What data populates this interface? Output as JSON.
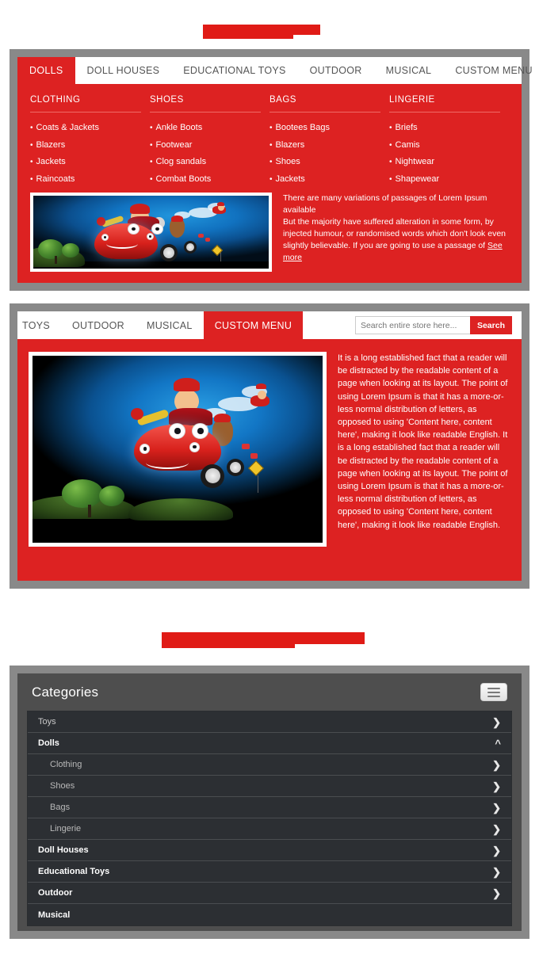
{
  "redacted_titles": [
    {
      "name": "title-block-top"
    },
    {
      "name": "title-block-middle"
    }
  ],
  "megamenu": {
    "tabs": [
      {
        "label": "DOLLS",
        "active": true
      },
      {
        "label": "DOLL HOUSES",
        "active": false
      },
      {
        "label": "EDUCATIONAL TOYS",
        "active": false
      },
      {
        "label": "OUTDOOR",
        "active": false
      },
      {
        "label": "MUSICAL",
        "active": false
      },
      {
        "label": "CUSTOM MENU",
        "active": false
      }
    ],
    "columns": [
      {
        "title": "CLOTHING",
        "items": [
          "Coats & Jackets",
          "Blazers",
          "Jackets",
          "Raincoats"
        ]
      },
      {
        "title": "SHOES",
        "items": [
          "Ankle Boots",
          "Footwear",
          "Clog sandals",
          "Combat Boots"
        ]
      },
      {
        "title": "BAGS",
        "items": [
          "Bootees  Bags",
          "Blazers",
          "Shoes",
          "Jackets"
        ]
      },
      {
        "title": "LINGERIE",
        "items": [
          "Briefs",
          "Camis",
          "Nightwear",
          "Shapewear"
        ]
      }
    ],
    "promo_text_1": "There are many variations of passages of Lorem Ipsum available",
    "promo_text_2": "But the majority have suffered alteration in some form, by injected humour, or randomised words which don't look even slightly believable. If you are going to use a passage of ",
    "promo_link": "See more",
    "image_alt": "cartoon-red-car-with-characters"
  },
  "searchpanel": {
    "tabs": [
      {
        "label": "TOYS",
        "active": false,
        "clipped": true
      },
      {
        "label": "OUTDOOR",
        "active": false,
        "clipped": false
      },
      {
        "label": "MUSICAL",
        "active": false,
        "clipped": false
      },
      {
        "label": "CUSTOM MENU",
        "active": true,
        "clipped": false
      }
    ],
    "search": {
      "placeholder": "Search entire store here...",
      "value": "",
      "button_label": "Search"
    },
    "body_text": "It is a long established fact that a reader will be distracted by the readable content of a page when looking at its layout. The point of using Lorem Ipsum is that it has a more-or-less normal distribution of letters, as opposed to using 'Content here, content here', making it look like readable English. It is a long established fact that a reader will be distracted by the readable content of a page when looking at its layout. The point of using Lorem Ipsum is that it has a more-or-less normal distribution of letters, as opposed to using 'Content here, content here', making it look like readable English.",
    "image_alt": "cartoon-red-car-flying-over-hill"
  },
  "categories": {
    "title": "Categories",
    "toggle_icon": "hamburger-icon",
    "rows": [
      {
        "label": "Toys",
        "level": 0,
        "bold": false,
        "chevron": "right"
      },
      {
        "label": "Dolls",
        "level": 0,
        "bold": true,
        "chevron": "up"
      },
      {
        "label": "Clothing",
        "level": 1,
        "bold": false,
        "chevron": "right"
      },
      {
        "label": "Shoes",
        "level": 1,
        "bold": false,
        "chevron": "right"
      },
      {
        "label": "Bags",
        "level": 1,
        "bold": false,
        "chevron": "right"
      },
      {
        "label": "Lingerie",
        "level": 1,
        "bold": false,
        "chevron": "right"
      },
      {
        "label": "Doll Houses",
        "level": 0,
        "bold": true,
        "chevron": "right"
      },
      {
        "label": "Educational Toys",
        "level": 0,
        "bold": true,
        "chevron": "right"
      },
      {
        "label": "Outdoor",
        "level": 0,
        "bold": true,
        "chevron": "right"
      },
      {
        "label": "Musical",
        "level": 0,
        "bold": true,
        "chevron": "none"
      }
    ]
  },
  "colors": {
    "brand_red": "#dd2222",
    "redact_red": "#e01b16",
    "frame_gray": "#898989",
    "panel_dark": "#4e4e4e",
    "row_dark": "#2c2f33"
  }
}
